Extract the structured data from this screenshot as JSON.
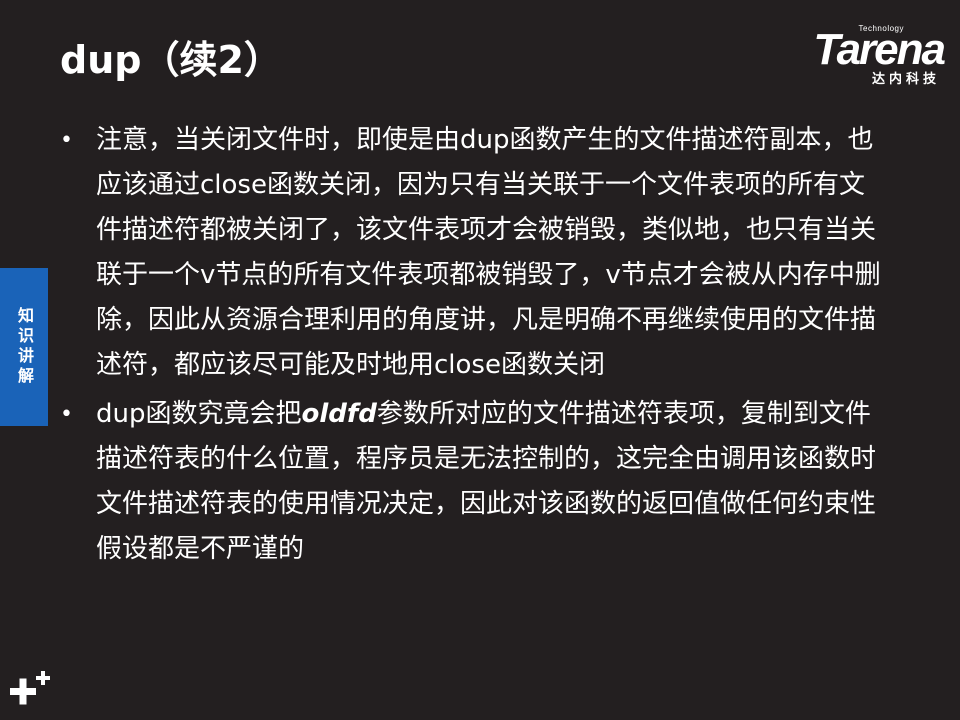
{
  "title": "dup（续2）",
  "logo": {
    "tagline": "Technology",
    "wordmark": "Tarena",
    "subtitle": "达内科技"
  },
  "side_tab": "知识讲解",
  "bullets": [
    {
      "text": "注意，当关闭文件时，即使是由dup函数产生的文件描述符副本，也应该通过close函数关闭，因为只有当关联于一个文件表项的所有文件描述符都被关闭了，该文件表项才会被销毁，类似地，也只有当关联于一个v节点的所有文件表项都被销毁了，v节点才会被从内存中删除，因此从资源合理利用的角度讲，凡是明确不再继续使用的文件描述符，都应该尽可能及时地用close函数关闭"
    },
    {
      "pre": "dup函数究竟会把",
      "em": "oldfd",
      "post": "参数所对应的文件描述符表项，复制到文件描述符表的什么位置，程序员是无法控制的，这完全由调用该函数时文件描述符表的使用情况决定，因此对该函数的返回值做任何约束性假设都是不严谨的"
    }
  ],
  "bullet_symbol": "•"
}
